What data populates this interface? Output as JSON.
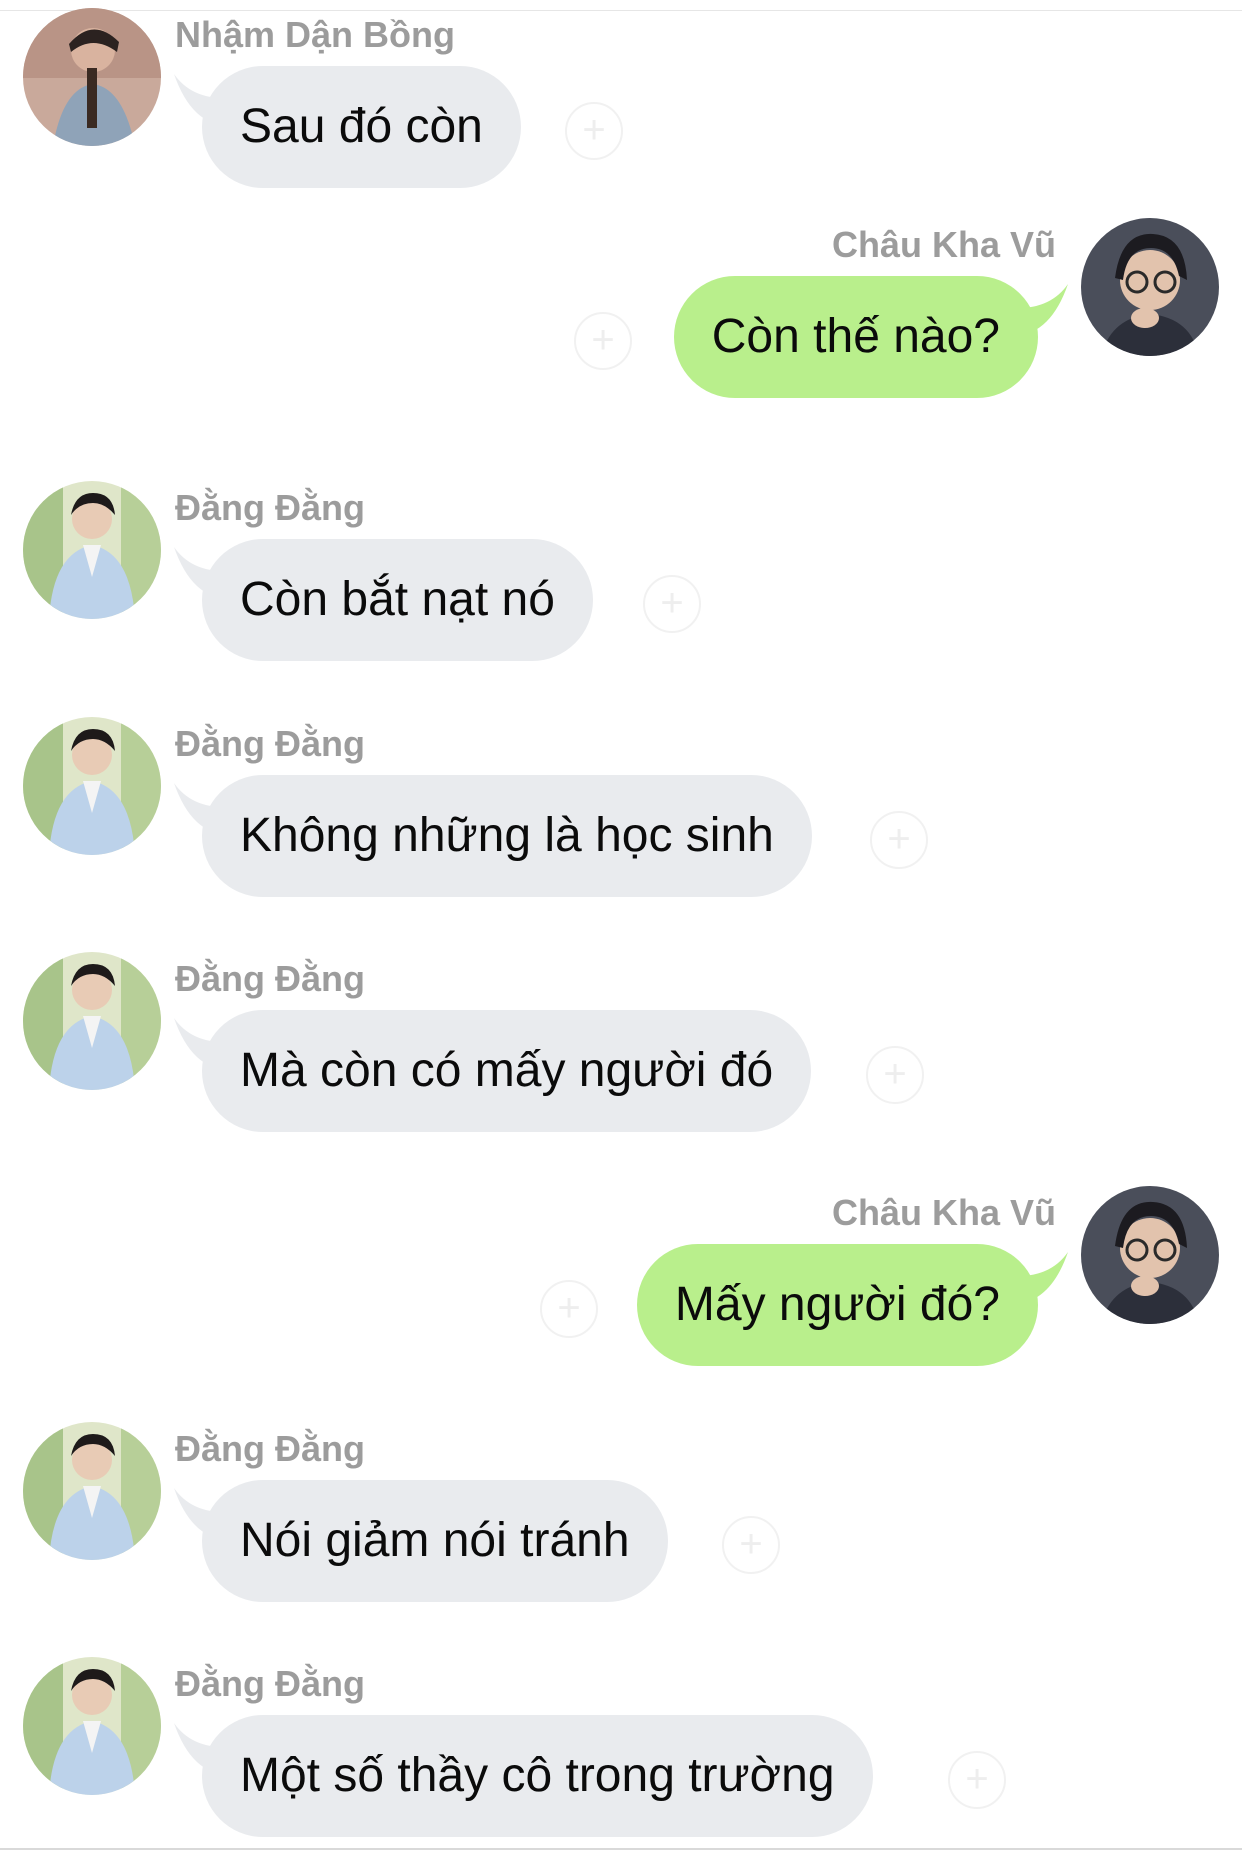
{
  "messages": [
    {
      "side": "left",
      "sender": "Nhậm Dận Bồng",
      "text": "Sau đó còn",
      "avatar": "nham-dan-bong-avatar"
    },
    {
      "side": "right",
      "sender": "Châu Kha Vũ",
      "text": "Còn thế nào?",
      "avatar": "chau-kha-vu-avatar"
    },
    {
      "side": "left",
      "sender": "Đằng Đằng",
      "text": "Còn bắt nạt nó",
      "avatar": "dang-dang-avatar"
    },
    {
      "side": "left",
      "sender": "Đằng Đằng",
      "text": "Không những là học sinh",
      "avatar": "dang-dang-avatar"
    },
    {
      "side": "left",
      "sender": "Đằng Đằng",
      "text": "Mà còn có mấy người đó",
      "avatar": "dang-dang-avatar"
    },
    {
      "side": "right",
      "sender": "Châu Kha Vũ",
      "text": "Mấy người đó?",
      "avatar": "chau-kha-vu-avatar"
    },
    {
      "side": "left",
      "sender": "Đằng Đằng",
      "text": "Nói giảm nói tránh",
      "avatar": "dang-dang-avatar"
    },
    {
      "side": "left",
      "sender": "Đằng Đằng",
      "text": "Một số thầy cô trong trường",
      "avatar": "dang-dang-avatar"
    }
  ],
  "colors": {
    "incoming_bubble": "#e9ebee",
    "outgoing_bubble": "#b9ef8c",
    "sender_name": "#9c9c9c",
    "message_text": "#0b0b0b"
  },
  "icons": {
    "reaction": "add-reaction-icon"
  }
}
